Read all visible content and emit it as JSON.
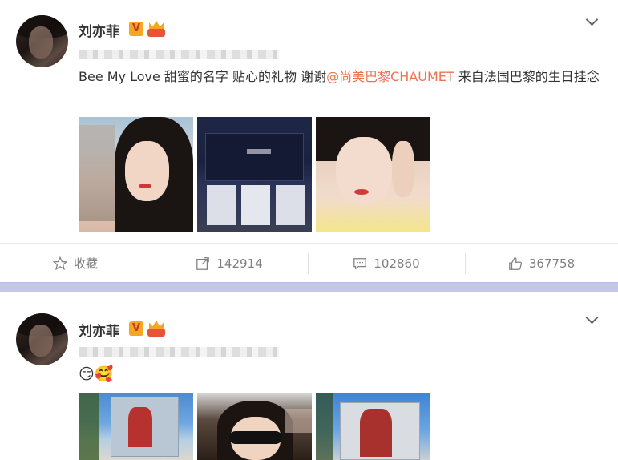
{
  "posts": [
    {
      "username": "刘亦菲",
      "badge": "V",
      "text_prefix": "Bee My Love 甜蜜的名字 贴心的礼物 谢谢",
      "mention": "@尚美巴黎CHAUMET",
      "text_suffix": " 来自法国巴黎的生日挂念",
      "actions": {
        "favorite_label": "收藏",
        "repost_count": "142914",
        "comment_count": "102860",
        "like_count": "367758"
      }
    },
    {
      "username": "刘亦菲",
      "badge": "V",
      "emoji_text": "😏🥰"
    }
  ],
  "colors": {
    "mention": "#eb7350",
    "separator": "#c5c7ea",
    "action_text": "#808080"
  },
  "icons": [
    "star-icon",
    "repost-icon",
    "comment-icon",
    "thumbs-up-icon",
    "chevron-down-icon",
    "verified-badge-icon",
    "vip-crown-icon"
  ]
}
